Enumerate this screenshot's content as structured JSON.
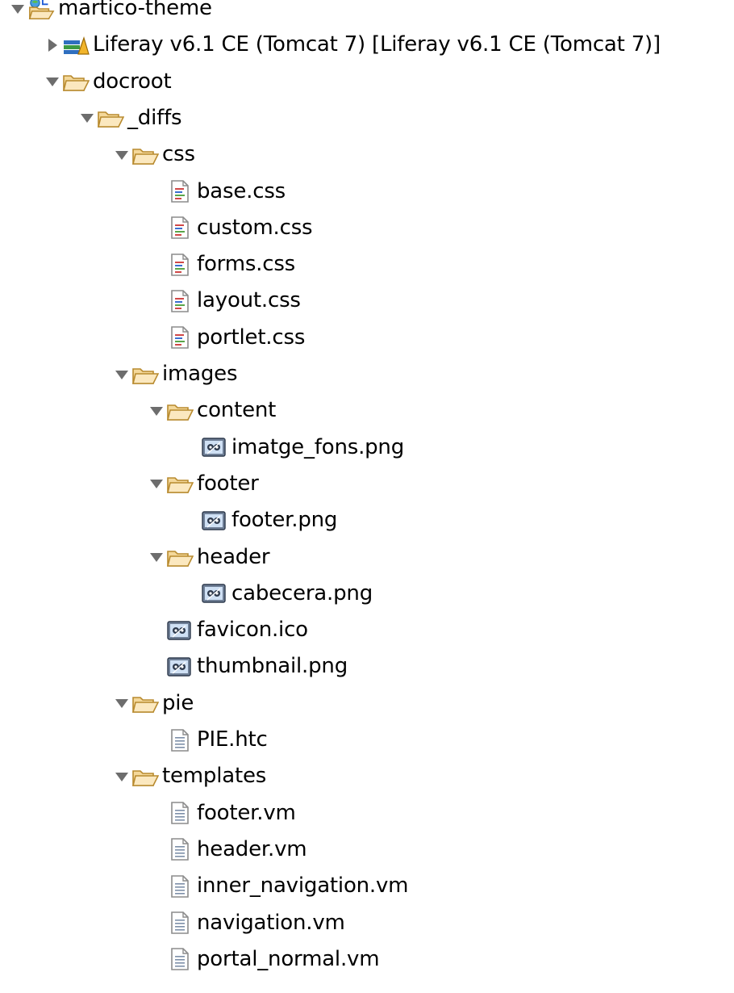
{
  "tree": {
    "nodes": [
      {
        "id": "martico-theme",
        "label": "martico-theme",
        "depth": 0,
        "kind": "project",
        "expanded": true,
        "icon": "liferay-project-icon"
      },
      {
        "id": "liferay-runtime",
        "label": "Liferay v6.1 CE (Tomcat 7) [Liferay v6.1 CE (Tomcat 7)]",
        "depth": 1,
        "kind": "library",
        "expanded": false,
        "icon": "library-icon"
      },
      {
        "id": "docroot",
        "label": "docroot",
        "depth": 1,
        "kind": "folder",
        "expanded": true,
        "icon": "folder-icon"
      },
      {
        "id": "diffs",
        "label": "_diffs",
        "depth": 2,
        "kind": "folder",
        "expanded": true,
        "icon": "folder-icon"
      },
      {
        "id": "css",
        "label": "css",
        "depth": 3,
        "kind": "folder",
        "expanded": true,
        "icon": "folder-icon"
      },
      {
        "id": "base-css",
        "label": "base.css",
        "depth": 4,
        "kind": "css-file",
        "icon": "css-file-icon"
      },
      {
        "id": "custom-css",
        "label": "custom.css",
        "depth": 4,
        "kind": "css-file",
        "icon": "css-file-icon"
      },
      {
        "id": "forms-css",
        "label": "forms.css",
        "depth": 4,
        "kind": "css-file",
        "icon": "css-file-icon"
      },
      {
        "id": "layout-css",
        "label": "layout.css",
        "depth": 4,
        "kind": "css-file",
        "icon": "css-file-icon"
      },
      {
        "id": "portlet-css",
        "label": "portlet.css",
        "depth": 4,
        "kind": "css-file",
        "icon": "css-file-icon"
      },
      {
        "id": "images",
        "label": "images",
        "depth": 3,
        "kind": "folder",
        "expanded": true,
        "icon": "folder-icon"
      },
      {
        "id": "content",
        "label": "content",
        "depth": 4,
        "kind": "folder",
        "expanded": true,
        "icon": "folder-icon"
      },
      {
        "id": "imatge-fons-png",
        "label": "imatge_fons.png",
        "depth": 5,
        "kind": "image-file",
        "icon": "image-file-icon"
      },
      {
        "id": "footer",
        "label": "footer",
        "depth": 4,
        "kind": "folder",
        "expanded": true,
        "icon": "folder-icon"
      },
      {
        "id": "footer-png",
        "label": "footer.png",
        "depth": 5,
        "kind": "image-file",
        "icon": "image-file-icon"
      },
      {
        "id": "header",
        "label": "header",
        "depth": 4,
        "kind": "folder",
        "expanded": true,
        "icon": "folder-icon"
      },
      {
        "id": "cabecera-png",
        "label": "cabecera.png",
        "depth": 5,
        "kind": "image-file",
        "icon": "image-file-icon"
      },
      {
        "id": "favicon-ico",
        "label": "favicon.ico",
        "depth": 4,
        "kind": "image-file",
        "icon": "image-file-icon"
      },
      {
        "id": "thumbnail-png",
        "label": "thumbnail.png",
        "depth": 4,
        "kind": "image-file",
        "icon": "image-file-icon"
      },
      {
        "id": "pie",
        "label": "pie",
        "depth": 3,
        "kind": "folder",
        "expanded": true,
        "icon": "folder-icon"
      },
      {
        "id": "pie-htc",
        "label": "PIE.htc",
        "depth": 4,
        "kind": "text-file",
        "icon": "text-file-icon"
      },
      {
        "id": "templates",
        "label": "templates",
        "depth": 3,
        "kind": "folder",
        "expanded": true,
        "icon": "folder-icon"
      },
      {
        "id": "footer-vm",
        "label": "footer.vm",
        "depth": 4,
        "kind": "text-file",
        "icon": "text-file-icon"
      },
      {
        "id": "header-vm",
        "label": "header.vm",
        "depth": 4,
        "kind": "text-file",
        "icon": "text-file-icon"
      },
      {
        "id": "inner-navigation-vm",
        "label": "inner_navigation.vm",
        "depth": 4,
        "kind": "text-file",
        "icon": "text-file-icon"
      },
      {
        "id": "navigation-vm",
        "label": "navigation.vm",
        "depth": 4,
        "kind": "text-file",
        "icon": "text-file-icon"
      },
      {
        "id": "portal-normal-vm",
        "label": "portal_normal.vm",
        "depth": 4,
        "kind": "text-file",
        "icon": "text-file-icon"
      }
    ]
  },
  "colors": {
    "twisty": "#6d6d6d",
    "folder_fill": "#f4d89a",
    "folder_stroke": "#b88a2e"
  }
}
